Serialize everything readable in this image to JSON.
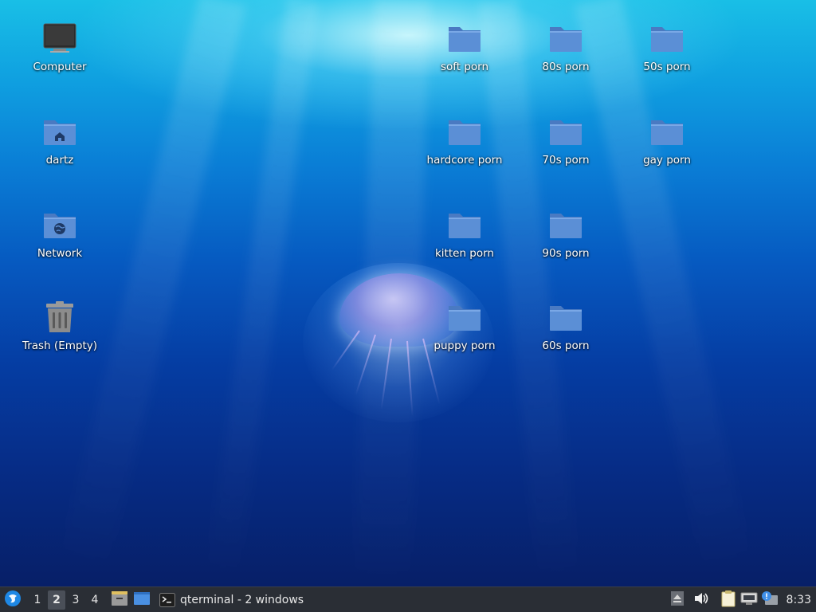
{
  "desktop": {
    "icons": [
      {
        "id": "computer",
        "label": "Computer",
        "icon": "computer-icon"
      },
      {
        "id": "home",
        "label": "dartz",
        "icon": "home-folder-icon"
      },
      {
        "id": "network",
        "label": "Network",
        "icon": "network-folder-icon"
      },
      {
        "id": "trash",
        "label": "Trash (Empty)",
        "icon": "trash-icon"
      },
      {
        "id": "soft",
        "label": "soft porn",
        "icon": "folder-icon"
      },
      {
        "id": "80s",
        "label": "80s porn",
        "icon": "folder-icon"
      },
      {
        "id": "50s",
        "label": "50s porn",
        "icon": "folder-icon"
      },
      {
        "id": "hardcore",
        "label": "hardcore porn",
        "icon": "folder-icon"
      },
      {
        "id": "70s",
        "label": "70s porn",
        "icon": "folder-icon"
      },
      {
        "id": "gay",
        "label": "gay porn",
        "icon": "folder-icon"
      },
      {
        "id": "kitten",
        "label": "kitten porn",
        "icon": "folder-icon"
      },
      {
        "id": "90s",
        "label": "90s porn",
        "icon": "folder-icon"
      },
      {
        "id": "puppy",
        "label": "puppy porn",
        "icon": "folder-icon"
      },
      {
        "id": "60s",
        "label": "60s porn",
        "icon": "folder-icon"
      }
    ]
  },
  "taskbar": {
    "start_icon": "lxqt-start-menu-icon",
    "workspaces": [
      "1",
      "2",
      "3",
      "4"
    ],
    "active_workspace": "2",
    "launchers": [
      "file-manager-icon",
      "show-desktop-icon"
    ],
    "task": {
      "label": "qterminal - 2 windows",
      "icon": "terminal-icon"
    },
    "tray": [
      "eject-icon",
      "volume-icon",
      "clipboard-icon",
      "network-icon",
      "update-notifier-icon"
    ],
    "clock": "8:33"
  },
  "colors": {
    "folder": "#5b8fd6",
    "folder_tab": "#4a7ac2",
    "taskbar_bg": "#2a2e35",
    "accent": "#1e88e5"
  }
}
